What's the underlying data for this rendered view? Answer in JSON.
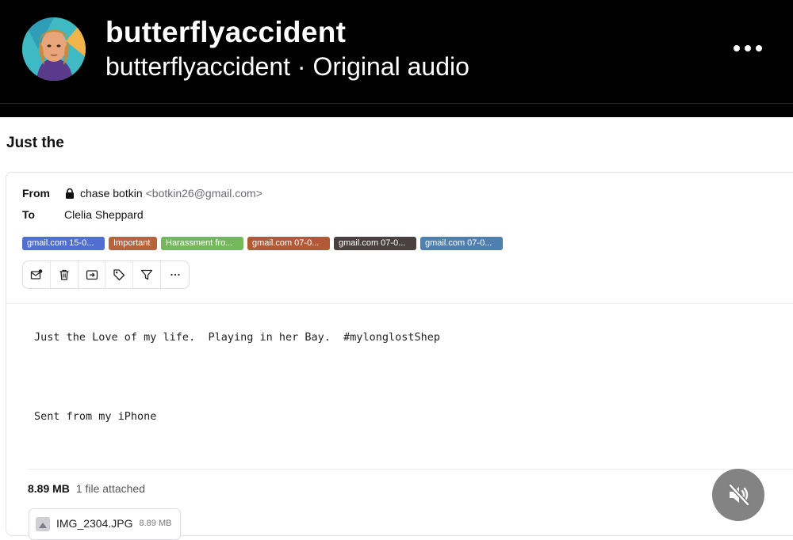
{
  "overlay": {
    "username": "butterflyaccident",
    "audio_line": "butterflyaccident · Original audio",
    "more_icon": "more-horizontal-icon",
    "mute_icon": "speaker-muted-icon"
  },
  "email": {
    "subject": "Just the",
    "from_label": "From",
    "sender_name": "chase botkin",
    "sender_email": "<botkin26@gmail.com>",
    "to_label": "To",
    "recipient": "Clelia Sheppard",
    "tags": [
      {
        "label": "gmail.com 15-0...",
        "color": "#4f6fd3"
      },
      {
        "label": "Important",
        "color": "#b9633a"
      },
      {
        "label": "Harassment fro...",
        "color": "#74b85a"
      },
      {
        "label": "gmail.com 07-0...",
        "color": "#b25a34"
      },
      {
        "label": "gmail.com 07-0...",
        "color": "#4a4040"
      },
      {
        "label": "gmail.com 07-0...",
        "color": "#4f7fae"
      }
    ],
    "toolbar": [
      "mark-unread-icon",
      "trash-icon",
      "move-to-folder-icon",
      "tag-icon",
      "filter-icon",
      "more-icon"
    ],
    "body_line1": "Just the Love of my life.  Playing in her Bay.  #mylonglostShep",
    "body_line2": "Sent from my iPhone",
    "attachments": {
      "total_size": "8.89 MB",
      "count_text": "1 file attached",
      "file_name": "IMG_2304.JPG",
      "file_size": "8.89 MB"
    }
  }
}
